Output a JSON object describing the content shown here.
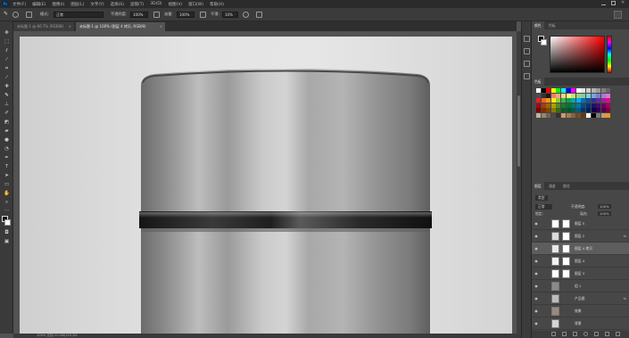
{
  "app": {
    "logo_text": "Ps"
  },
  "menu": [
    "文件(F)",
    "编辑(E)",
    "图像(I)",
    "图层(L)",
    "文字(Y)",
    "选择(S)",
    "滤镜(T)",
    "3D(D)",
    "视图(V)",
    "窗口(W)",
    "帮助(H)"
  ],
  "options_bar": {
    "mode_label": "模式:",
    "mode_value": "正常",
    "opacity_label": "不透明度:",
    "opacity_value": "100%",
    "flow_label": "流量:",
    "flow_value": "100%",
    "smooth_label": "平滑:",
    "smooth_value": "10%"
  },
  "tabs": [
    {
      "label": "未标题-1 @ 66.7% (RGB/8)",
      "close": "×"
    },
    {
      "label": "未标题-1 @ 100% (图层 4 拷贝, RGB/8)",
      "close": "×"
    }
  ],
  "status_text": "100%   文档:12.0M/155.2M",
  "tool_icons": [
    "move",
    "marquee",
    "lasso",
    "magic-wand",
    "crop",
    "eyedropper",
    "healing",
    "brush",
    "stamp",
    "history-brush",
    "eraser",
    "gradient",
    "blur",
    "dodge",
    "pen",
    "type",
    "path-select",
    "shape",
    "hand",
    "zoom"
  ],
  "color_panel": {
    "tabs": [
      "颜色",
      "色板"
    ],
    "fg": "#000000",
    "bg": "#ffffff"
  },
  "swatches_panel": {
    "tab": "色板"
  },
  "swatch_colors": [
    "#ffffff",
    "#000000",
    "#ff0000",
    "#ffff00",
    "#00ff00",
    "#00ffff",
    "#0000ff",
    "#ff00ff",
    "#ffffff",
    "#e6e6e6",
    "#cccccc",
    "#b3b3b3",
    "#999999",
    "#808080",
    "#666666",
    "#4d4d4d",
    "#333333",
    "#1a1a1a",
    "#f27b7b",
    "#f6a57b",
    "#fbd27b",
    "#fff27b",
    "#c5e27b",
    "#9bd27b",
    "#7bd2a5",
    "#7bd2d2",
    "#7ba5d2",
    "#7b7bd2",
    "#a57bd2",
    "#d27bd2",
    "#ee1c24",
    "#f26522",
    "#f7941d",
    "#fff200",
    "#8dc63f",
    "#39b54a",
    "#00a651",
    "#00a99d",
    "#00aeef",
    "#0072bc",
    "#0054a6",
    "#2e3192",
    "#662d91",
    "#92278f",
    "#ec008c",
    "#9e0b0f",
    "#a0410d",
    "#a36209",
    "#aba000",
    "#598527",
    "#197b30",
    "#007236",
    "#00746b",
    "#0076a3",
    "#004b80",
    "#003471",
    "#1b1464",
    "#440e62",
    "#630460",
    "#9e005d",
    "#790000",
    "#7b2e00",
    "#7d4900",
    "#827b00",
    "#406618",
    "#005e20",
    "#005826",
    "#005952",
    "#005b7f",
    "#003663",
    "#002157",
    "#0d004c",
    "#32004b",
    "#4b0049",
    "#7b0046",
    "#c7b299",
    "#998675",
    "#736357",
    "#534741",
    "#37302d",
    "#c69c6d",
    "#a67c52",
    "#8c6239",
    "#754c24",
    "#603913",
    "#ffffff",
    "#000000",
    "#777777",
    "#c69c6d",
    "#f7941d"
  ],
  "layers_panel": {
    "tabs": [
      "图层",
      "通道",
      "路径"
    ],
    "kind_label": "类型",
    "blend_mode": "正常",
    "opacity_label": "不透明度:",
    "opacity_value": "100%",
    "lock_label": "锁定:",
    "fill_label": "填充:",
    "fill_value": "100%",
    "layers": [
      {
        "name": "图层 5",
        "fx": ""
      },
      {
        "name": "图层 2",
        "fx": "fx"
      },
      {
        "name": "图层 4 拷贝",
        "fx": ""
      },
      {
        "name": "图层 4",
        "fx": ""
      },
      {
        "name": "图层 3",
        "fx": ""
      },
      {
        "name": "组 1",
        "fx": ""
      },
      {
        "name": "产品图",
        "fx": "fx"
      },
      {
        "name": "效果",
        "fx": ""
      },
      {
        "name": "背景",
        "fx": ""
      }
    ]
  }
}
